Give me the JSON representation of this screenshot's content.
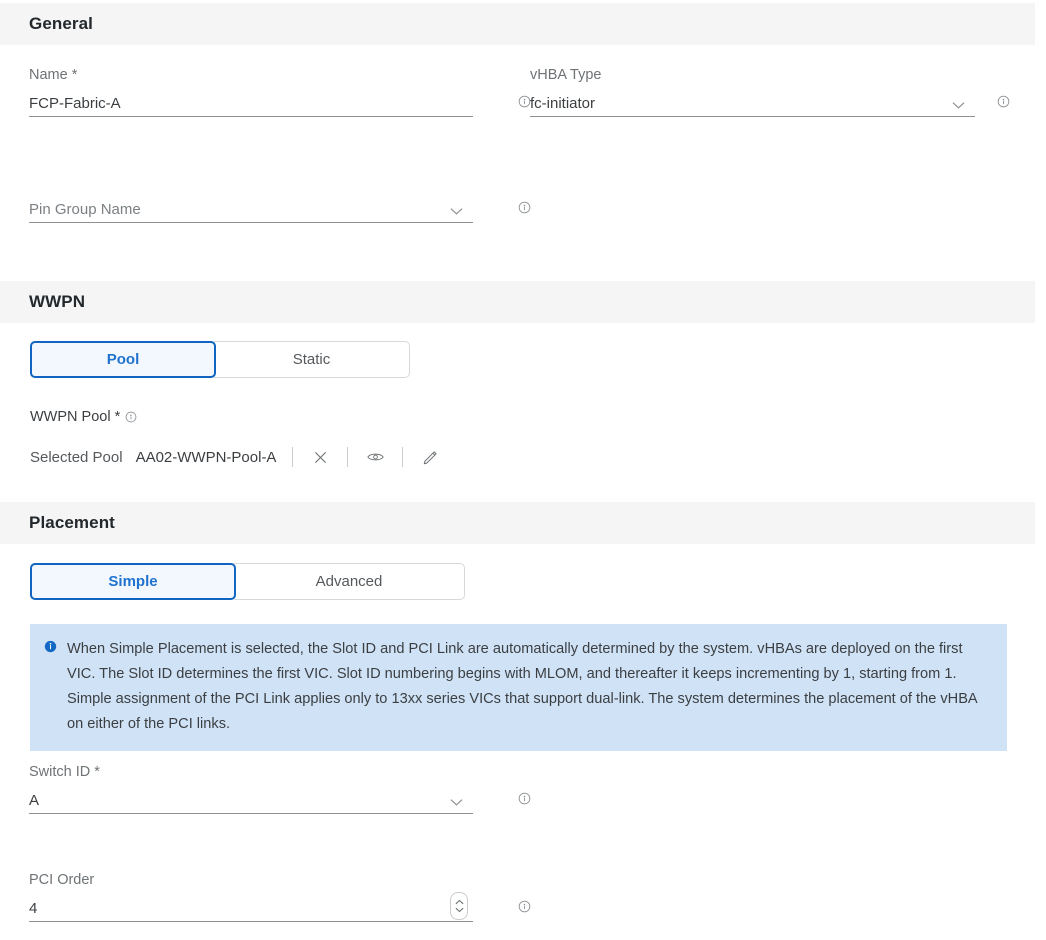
{
  "sections": {
    "general": {
      "title": "General",
      "name_field": {
        "label": "Name *",
        "value": "FCP-Fabric-A"
      },
      "vhba_type_field": {
        "label": "vHBA Type",
        "value": "fc-initiator"
      },
      "pin_group_field": {
        "placeholder": "Pin Group Name",
        "value": ""
      }
    },
    "wwpn": {
      "title": "WWPN",
      "toggle": {
        "options": [
          "Pool",
          "Static"
        ],
        "selected": "Pool"
      },
      "pool_label": "WWPN Pool *",
      "selected_pool_label": "Selected Pool",
      "selected_pool_value": "AA02-WWPN-Pool-A"
    },
    "placement": {
      "title": "Placement",
      "toggle": {
        "options": [
          "Simple",
          "Advanced"
        ],
        "selected": "Simple"
      },
      "info_message": "When Simple Placement is selected, the Slot ID and PCI Link are automatically determined by the system. vHBAs are deployed on the first VIC. The Slot ID determines the first VIC. Slot ID numbering begins with MLOM, and thereafter it keeps incrementing by 1, starting from 1. Simple assignment of the PCI Link applies only to 13xx series VICs that support dual-link. The system determines the placement of the vHBA on either of the PCI links.",
      "switch_id_field": {
        "label": "Switch ID *",
        "value": "A"
      },
      "pci_order_field": {
        "label": "PCI Order",
        "value": "4"
      }
    }
  },
  "icons": {
    "info": "info-circle-icon",
    "chevron_down": "chevron-down-icon",
    "clear": "close-icon",
    "view": "eye-icon",
    "edit": "pencil-icon",
    "stepper_up": "chevron-up-icon",
    "stepper_down": "chevron-down-icon",
    "alert": "info-filled-icon"
  },
  "colors": {
    "accent": "#1f72ce",
    "selected_border": "#1165c0",
    "selected_fill": "#f2f8fe",
    "section_header_bg": "#f5f5f6",
    "alert_bg": "#cfe2f6",
    "alert_icon": "#1268c3",
    "underline": "#8e9295",
    "label_text": "#6e7376"
  }
}
